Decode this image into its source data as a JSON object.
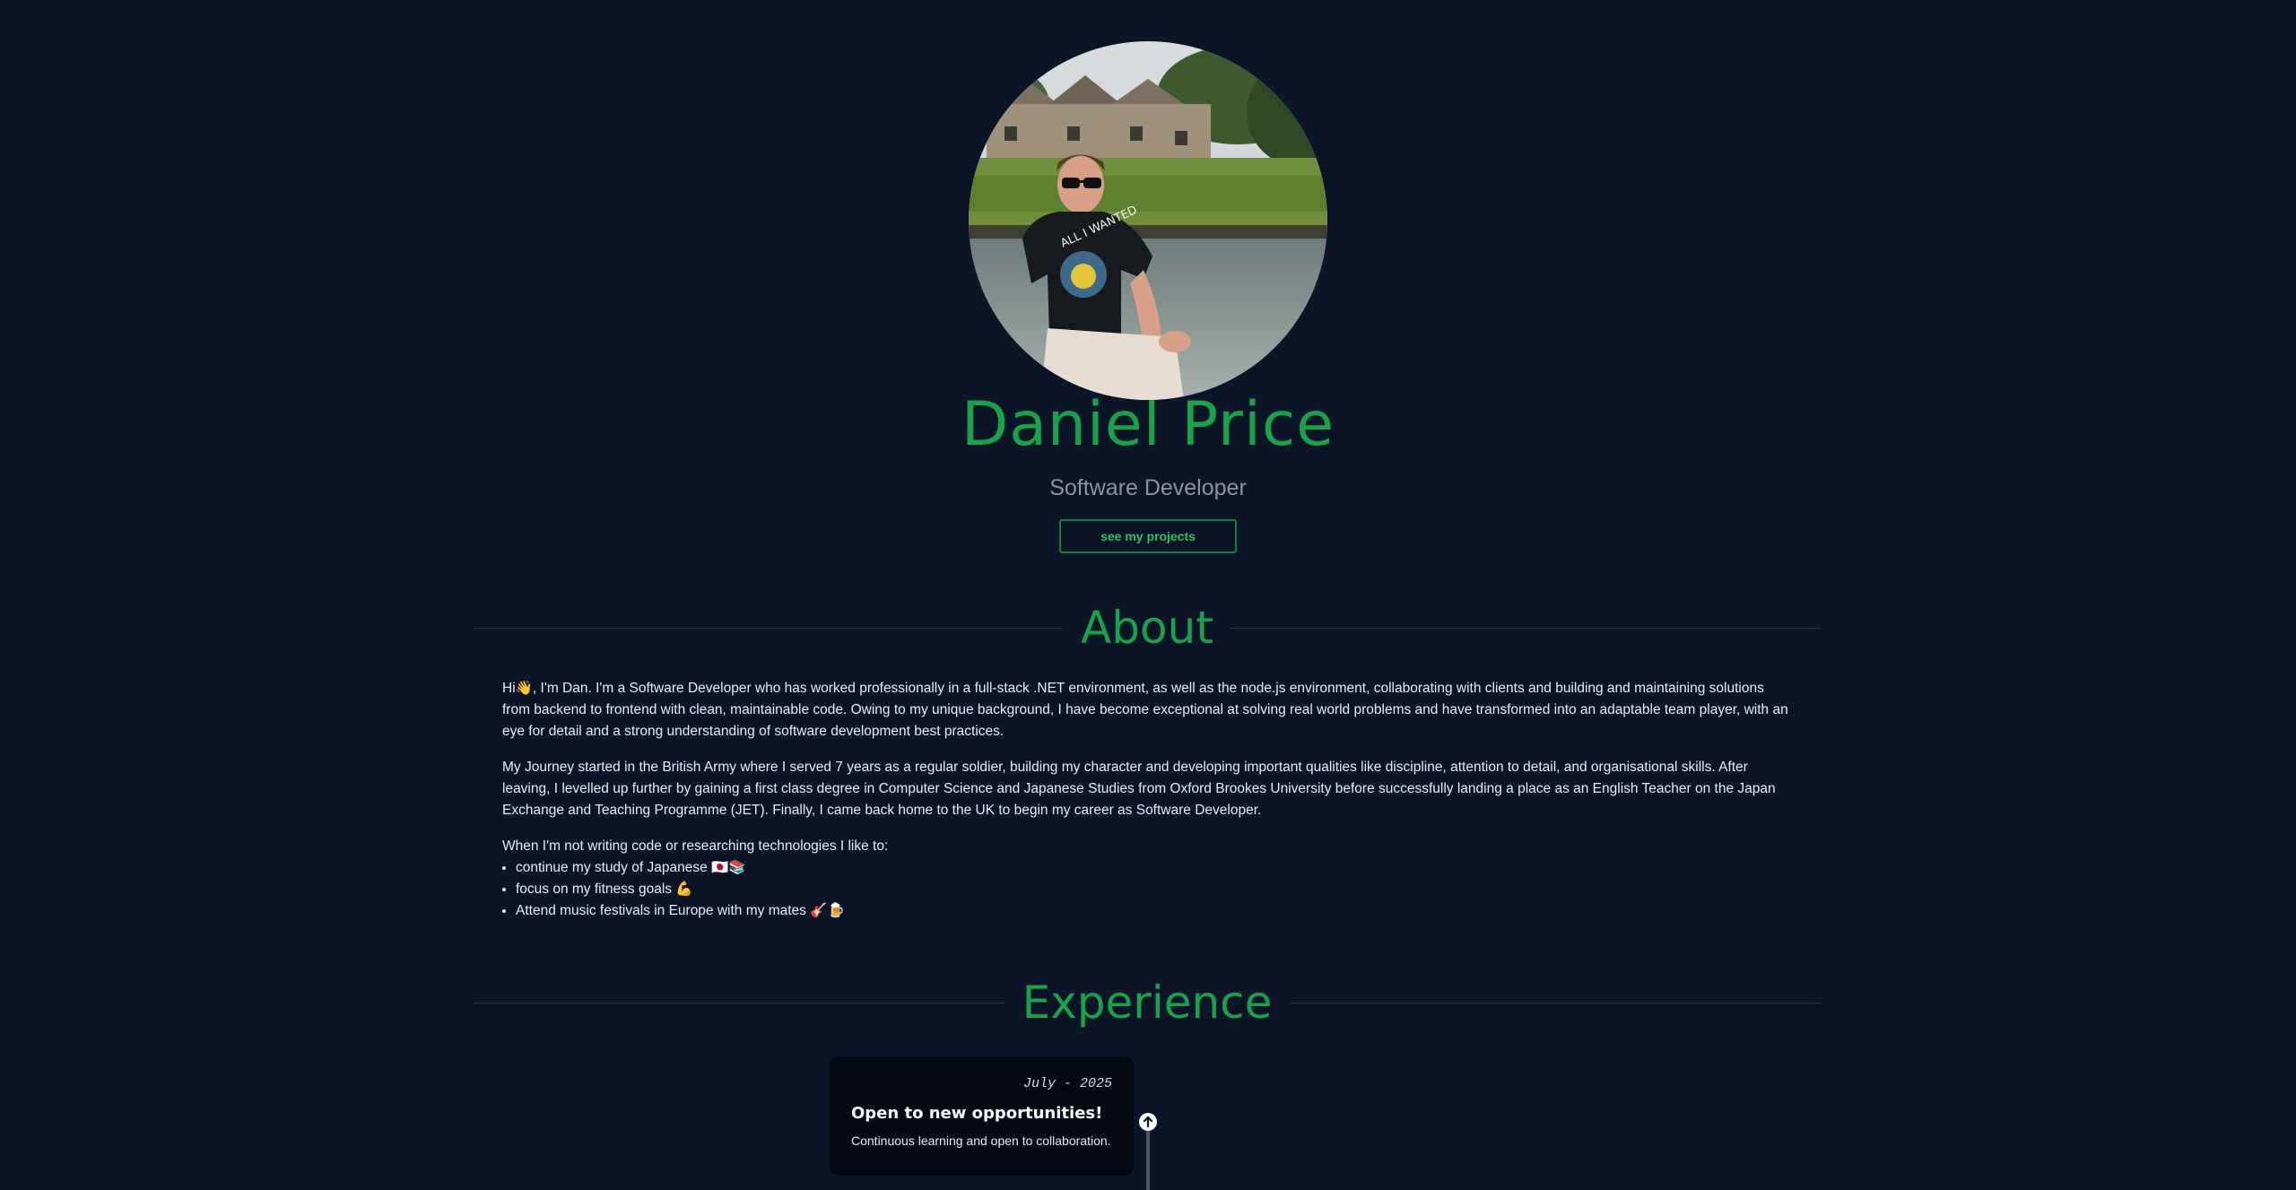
{
  "hero": {
    "avatar_alt": "profile-photo",
    "name": "Daniel Price",
    "role": "Software Developer",
    "cta_label": "see my projects"
  },
  "about": {
    "heading": "About",
    "paragraphs": [
      "Hi👋, I'm Dan. I'm a Software Developer who has worked professionally in a full-stack .NET environment, as well as the node.js environment, collaborating with clients and building and maintaining solutions from backend to frontend with clean, maintainable code. Owing to my unique background, I have become exceptional at solving real world problems and have transformed into an adaptable team player, with an eye for detail and a strong understanding of software development best practices.",
      "My Journey started in the British Army where I served 7 years as a regular soldier, building my character and developing important qualities like discipline, attention to detail, and organisational skills. After leaving, I levelled up further by gaining a first class degree in Computer Science and Japanese Studies from Oxford Brookes University before successfully landing a place as an English Teacher on the Japan Exchange and Teaching Programme (JET). Finally, I came back home to the UK to begin my career as Software Developer."
    ],
    "hobbies_intro": "When I'm not writing code or researching technologies I like to:",
    "hobbies": [
      "continue my study of Japanese 🇯🇵📚",
      "focus on my fitness goals 💪",
      "Attend music festivals in Europe with my mates 🎸🍺"
    ]
  },
  "experience": {
    "heading": "Experience",
    "items": [
      {
        "date": "July - 2025",
        "title": "Open to new opportunities!",
        "text": "Continuous learning and open to collaboration.",
        "icon": "arrow-up-icon"
      }
    ]
  },
  "colors": {
    "background": "#0c1427",
    "accent": "#16a34a",
    "card": "#050914"
  }
}
